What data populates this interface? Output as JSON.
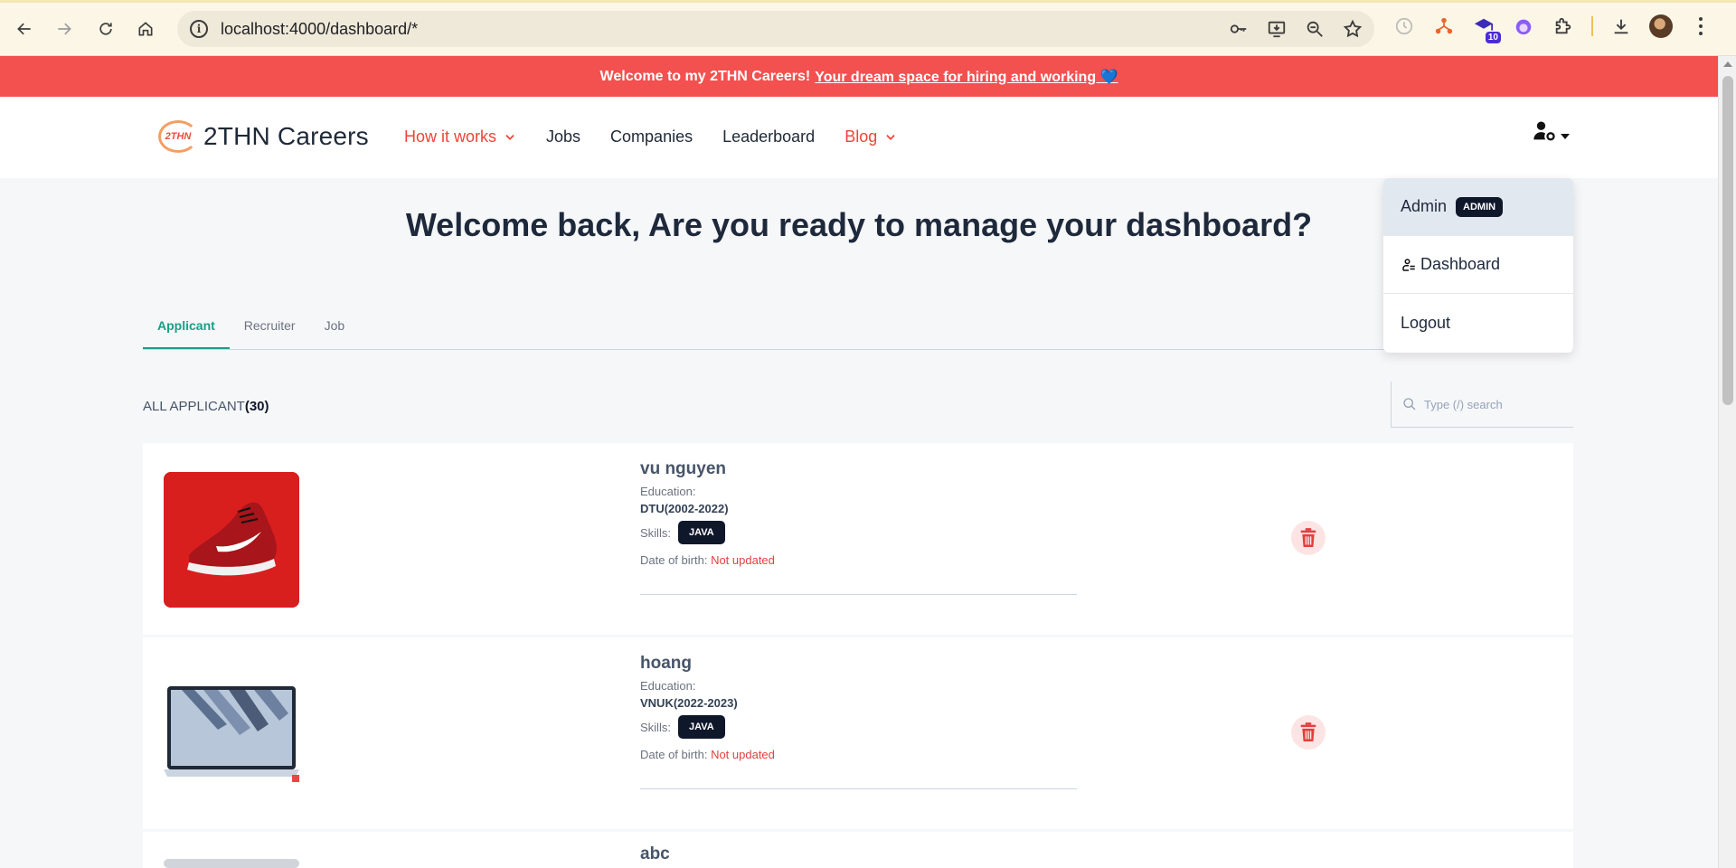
{
  "browser": {
    "url": "localhost:4000/dashboard/*",
    "extension_badge": "10"
  },
  "announcement": {
    "text": "Welcome to my 2THN Careers!",
    "link": "Your dream space for hiring and working 💙"
  },
  "header": {
    "logo_mark": "2THN",
    "logo_text": "2THN Careers",
    "nav": [
      {
        "label": "How it works"
      },
      {
        "label": "Jobs"
      },
      {
        "label": "Companies"
      },
      {
        "label": "Leaderboard"
      },
      {
        "label": "Blog"
      }
    ]
  },
  "user_menu": {
    "name": "Admin",
    "role_badge": "ADMIN",
    "items": [
      {
        "label": "Dashboard"
      },
      {
        "label": "Logout"
      }
    ]
  },
  "main": {
    "welcome": "Welcome back, Are you ready to manage your dashboard?",
    "tabs": [
      {
        "label": "Applicant"
      },
      {
        "label": "Recruiter"
      },
      {
        "label": "Job"
      }
    ],
    "section_label": "ALL APPLICANT",
    "section_count": "(30)",
    "search_placeholder": "Type (/) search"
  },
  "applicants": [
    {
      "name": "vu nguyen",
      "education_label": "Education:",
      "education": "DTU(2002-2022)",
      "skills_label": "Skills:",
      "skill": "JAVA",
      "dob_label": "Date of birth:",
      "dob": "Not updated"
    },
    {
      "name": "hoang",
      "education_label": "Education:",
      "education": "VNUK(2022-2023)",
      "skills_label": "Skills:",
      "skill": "JAVA",
      "dob_label": "Date of birth:",
      "dob": "Not updated"
    },
    {
      "name": "abc"
    }
  ],
  "colors": {
    "announcement": "#f35050",
    "accent_nav": "#f04438",
    "tab_active": "#16a085",
    "badge_dark": "#0f172a",
    "delete_red": "#e53e3e"
  }
}
